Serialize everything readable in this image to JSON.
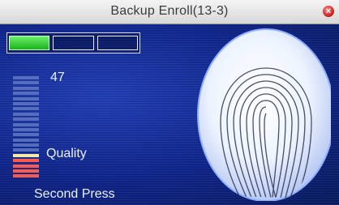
{
  "window": {
    "title": "Backup Enroll(13-3)",
    "close_glyph": "×"
  },
  "progress": {
    "total_steps": 3,
    "completed_steps": 1,
    "filled_color": "#22c422"
  },
  "quality": {
    "value": "47",
    "label": "Quality",
    "meter_level_fraction": 0.25,
    "colors": {
      "empty": "#6b82c6",
      "warning": "#f6e9a6",
      "low": "#ff5a4a"
    }
  },
  "status": {
    "text": "Second Press"
  },
  "icons": {
    "close": "close-icon",
    "fingerprint": "fingerprint-icon"
  }
}
